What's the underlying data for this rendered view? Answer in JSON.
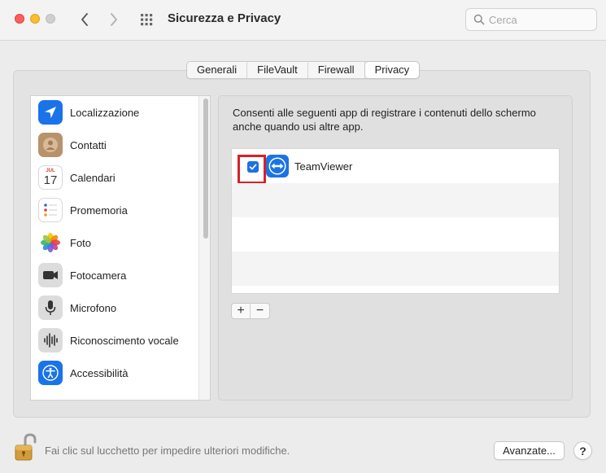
{
  "window": {
    "title": "Sicurezza e Privacy"
  },
  "search": {
    "placeholder": "Cerca",
    "icon": "search-icon"
  },
  "tabs": [
    {
      "label": "Generali",
      "active": false
    },
    {
      "label": "FileVault",
      "active": false
    },
    {
      "label": "Firewall",
      "active": false
    },
    {
      "label": "Privacy",
      "active": true
    }
  ],
  "sidebar": {
    "items": [
      {
        "label": "Localizzazione",
        "icon": "location-arrow-icon"
      },
      {
        "label": "Contatti",
        "icon": "contacts-icon"
      },
      {
        "label": "Calendari",
        "icon": "calendar-icon",
        "icon_month": "JUL",
        "icon_day": "17"
      },
      {
        "label": "Promemoria",
        "icon": "reminders-icon"
      },
      {
        "label": "Foto",
        "icon": "photos-icon"
      },
      {
        "label": "Fotocamera",
        "icon": "camera-icon"
      },
      {
        "label": "Microfono",
        "icon": "microphone-icon"
      },
      {
        "label": "Riconoscimento vocale",
        "icon": "waveform-icon"
      },
      {
        "label": "Accessibilità",
        "icon": "accessibility-icon"
      }
    ]
  },
  "content": {
    "description": "Consenti alle seguenti app di registrare i contenuti dello schermo anche quando usi altre app.",
    "apps": [
      {
        "name": "TeamViewer",
        "checked": true,
        "icon": "teamviewer-icon"
      }
    ],
    "add_label": "+",
    "remove_label": "−"
  },
  "footer": {
    "lock_text": "Fai clic sul lucchetto per impedire ulteriori modifiche.",
    "advanced_label": "Avanzate...",
    "help_label": "?"
  },
  "colors": {
    "accent": "#1e6fe6",
    "highlight": "#d8202a"
  }
}
